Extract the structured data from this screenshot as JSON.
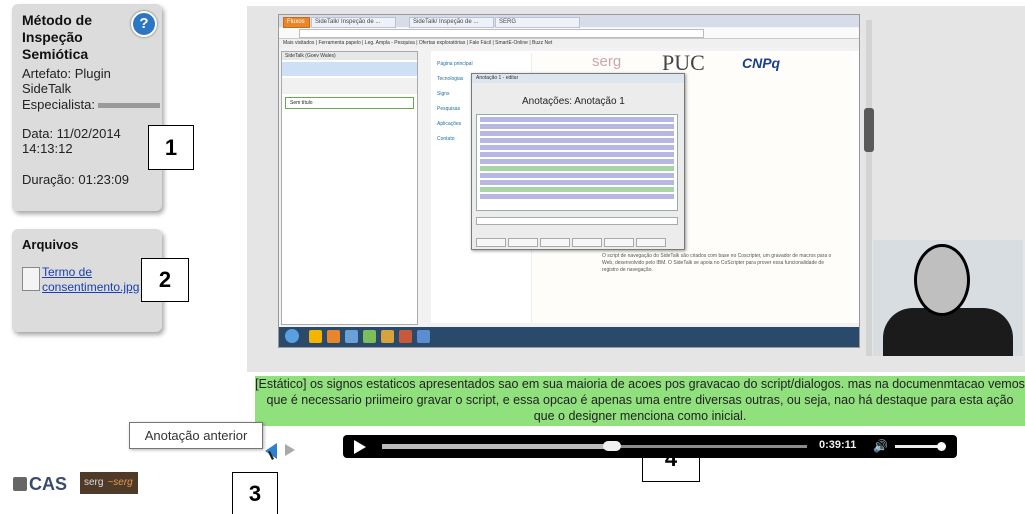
{
  "info": {
    "title": "Método de Inspeção Semiótica",
    "help": "?",
    "artifact": "Artefato: Plugin SideTalk",
    "specialist": "Especialista:",
    "date": "Data: 11/02/2014 14:13:12",
    "duration": "Duração: 01:23:09"
  },
  "files": {
    "title": "Arquivos",
    "link": "Termo de consentimento.jpg"
  },
  "badges": {
    "b1": "1",
    "b2": "2",
    "b3": "3",
    "b4": "4"
  },
  "screenshot": {
    "tabs": [
      "Fluxos",
      "SideTalk/ Inspeção de ...",
      "SideTalk/ Inspeção de ...",
      "SERG"
    ],
    "bookmarks": "Mais visitados | Ferramenta papelo | Leg. Ampla - Pesquisa | Ofertas exploratórias | Fale Fácil | SmartE-Online | Buzz Net",
    "sidetalk_header": "SideTalk (Goev Wales)",
    "sidetalk_item": "Sem título",
    "nav": [
      "Página principal",
      "Tecnologias",
      "Signs",
      "Pesquisas",
      "Aplicações",
      "Contato"
    ],
    "logo_serg": "serg",
    "logo_puc": "PUC",
    "logo_cnpq": "CNPq",
    "dialog_title": "Anotação 1 - editar",
    "dialog_heading": "Anotações: Anotação 1",
    "webtext": "O script de navegação do SideTalk são criados com base no Coscripter, um gravador de macros para o Web, desenvolvido pelo IBM. O SideTalk se apoia no CoScripter para prover essa funcionalidade de registro de navegação."
  },
  "annotation": "[Estático] os signos estaticos apresentados sao em sua maioria de acoes pos gravacao do script/dialogos. mas na documenmtacao vemos que é necessario priimeiro gravar o script, e essa opcao é apenas uma entre diversas outras, ou seja, nao há destaque para esta ação que o designer menciona como inicial.",
  "tooltip": "Anotação anterior",
  "player": {
    "time": "0:39:11",
    "progress": 0.54
  },
  "logos": {
    "cas": "CAS",
    "serg": "serg"
  },
  "colors": {
    "annotation_bg": "#91e07e",
    "link": "#1a3fb5",
    "help": "#2c77c4"
  }
}
